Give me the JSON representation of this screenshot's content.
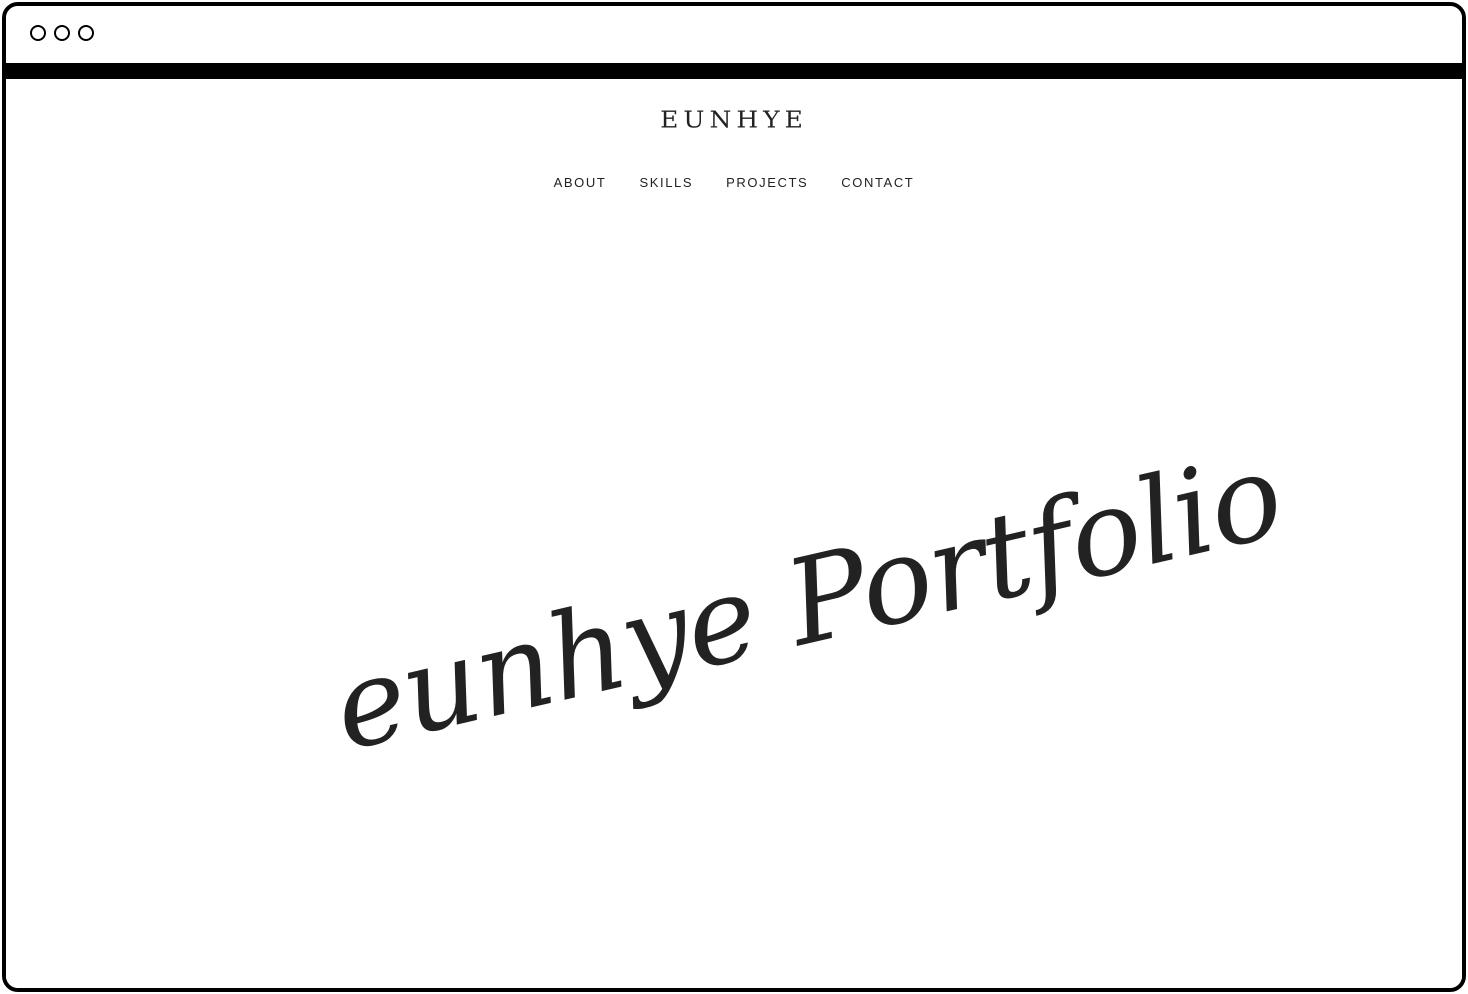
{
  "window": {
    "controls": [
      "circle-control-1",
      "circle-control-2",
      "circle-control-3"
    ]
  },
  "site": {
    "logo": "EUNHYE"
  },
  "nav": {
    "items": [
      {
        "label": "ABOUT"
      },
      {
        "label": "SKILLS"
      },
      {
        "label": "PROJECTS"
      },
      {
        "label": "CONTACT"
      }
    ]
  },
  "hero": {
    "script_text": "eunhye Portfolio"
  },
  "colors": {
    "frame": "#000000",
    "text": "#222222",
    "background": "#ffffff"
  }
}
